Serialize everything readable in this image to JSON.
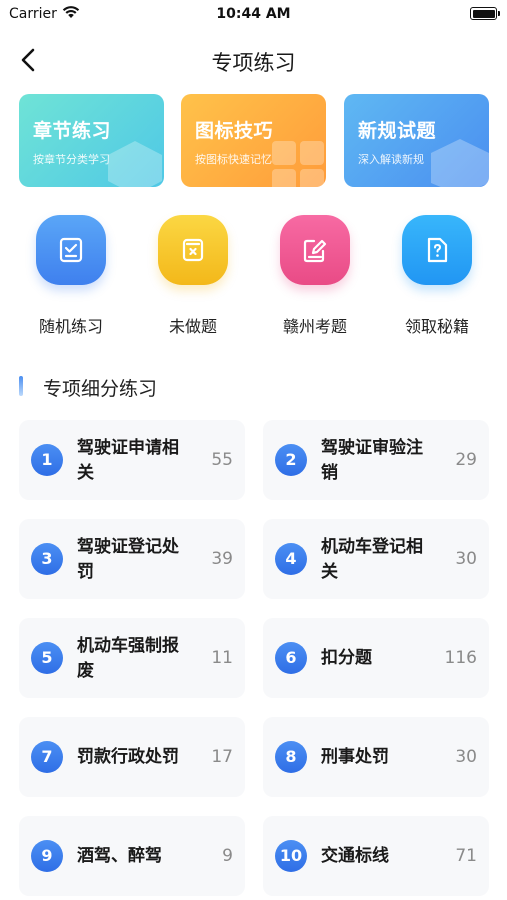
{
  "status_bar": {
    "carrier": "Carrier",
    "time": "10:44 AM"
  },
  "nav": {
    "title": "专项练习"
  },
  "cards": [
    {
      "title": "章节练习",
      "subtitle": "按章节分类学习"
    },
    {
      "title": "图标技巧",
      "subtitle": "按图标快速记忆"
    },
    {
      "title": "新规试题",
      "subtitle": "深入解读新规"
    }
  ],
  "quick_actions": [
    {
      "label": "随机练习",
      "icon": "checklist-icon"
    },
    {
      "label": "未做题",
      "icon": "undone-icon"
    },
    {
      "label": "赣州考题",
      "icon": "edit-icon"
    },
    {
      "label": "领取秘籍",
      "icon": "question-doc-icon"
    }
  ],
  "section": {
    "title": "专项细分练习"
  },
  "categories": [
    {
      "num": "1",
      "name": "驾驶证申请相关",
      "count": "55"
    },
    {
      "num": "2",
      "name": "驾驶证审验注销",
      "count": "29"
    },
    {
      "num": "3",
      "name": "驾驶证登记处罚",
      "count": "39"
    },
    {
      "num": "4",
      "name": "机动车登记相关",
      "count": "30"
    },
    {
      "num": "5",
      "name": "机动车强制报废",
      "count": "11"
    },
    {
      "num": "6",
      "name": "扣分题",
      "count": "116"
    },
    {
      "num": "7",
      "name": "罚款行政处罚",
      "count": "17"
    },
    {
      "num": "8",
      "name": "刑事处罚",
      "count": "30"
    },
    {
      "num": "9",
      "name": "酒驾、醉驾",
      "count": "9"
    },
    {
      "num": "10",
      "name": "交通标线",
      "count": "71"
    }
  ]
}
